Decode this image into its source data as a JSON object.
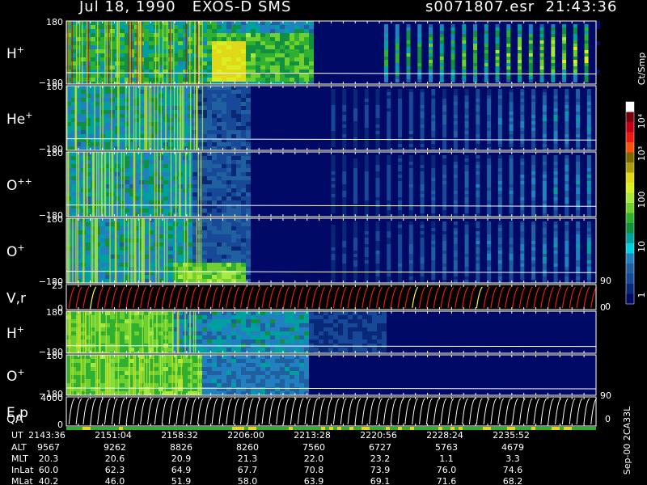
{
  "header": {
    "title": "Jul 18, 1990   EXOS-D SMS",
    "file_time": "s0071807.esr  21:43:36"
  },
  "colorbar": {
    "unit": "Ct/Smp",
    "labels": [
      "10⁴",
      "10³",
      "100",
      "10",
      "1"
    ],
    "colors": [
      "#ffffff",
      "#7a0010",
      "#c40014",
      "#ee1a10",
      "#ff5010",
      "#7a6a00",
      "#b09a10",
      "#e0d818",
      "#d8f020",
      "#a8e840",
      "#70d030",
      "#30b030",
      "#109040",
      "#00a0a0",
      "#00d0e0",
      "#2080c0",
      "#2060a0",
      "#184898",
      "#0a2878",
      "#000a66"
    ]
  },
  "panels": [
    {
      "name": "h-plus",
      "species": "H",
      "charge": "+",
      "ytop": "180",
      "ybot": "−180",
      "right_label": ""
    },
    {
      "name": "he-plus",
      "species": "He",
      "charge": "+",
      "ytop": "180",
      "ybot": "−180",
      "right_label": ""
    },
    {
      "name": "o-plus-plus",
      "species": "O",
      "charge": "++",
      "ytop": "180",
      "ybot": "−180",
      "right_label": ""
    },
    {
      "name": "o-plus",
      "species": "O",
      "charge": "+",
      "ytop": "180",
      "ybot": "−180",
      "right_label": "90"
    },
    {
      "name": "vr",
      "species": "V,r",
      "charge": "",
      "ytop": "25",
      "ybot": "0",
      "right_label": "0"
    },
    {
      "name": "h-plus-2",
      "species": "H",
      "charge": "+",
      "ytop": "180",
      "ybot": "−180",
      "right_label": ""
    },
    {
      "name": "o-plus-2",
      "species": "O",
      "charge": "+",
      "ytop": "180",
      "ybot": "−180",
      "right_label": ""
    },
    {
      "name": "ep",
      "species": "E,p",
      "charge": "",
      "ytop": "4000",
      "ybot": "0",
      "right_label": "90"
    }
  ],
  "qa_label": "QA",
  "ep_right_bottom": "0",
  "side_label": "Sep-00  2CA33L",
  "table": {
    "row_labels": [
      "UT",
      "ALT",
      "MLT",
      "InLat",
      "MLat"
    ],
    "columns": [
      [
        "2143:36",
        "9567",
        "20.3",
        "60.0",
        "40.2"
      ],
      [
        "2151:04",
        "9262",
        "20.6",
        "62.3",
        "46.0"
      ],
      [
        "2158:32",
        "8826",
        "20.9",
        "64.9",
        "51.9"
      ],
      [
        "2206:00",
        "8260",
        "21.3",
        "67.7",
        "58.0"
      ],
      [
        "2213:28",
        "7560",
        "22.0",
        "70.8",
        "63.9"
      ],
      [
        "2220:56",
        "6727",
        "23.2",
        "73.9",
        "69.1"
      ],
      [
        "2228:24",
        "5763",
        "1.1",
        "76.0",
        "71.6"
      ],
      [
        "2235:52",
        "4679",
        "3.3",
        "74.6",
        "68.2"
      ]
    ]
  },
  "chart_data": {
    "type": "heatmap",
    "title": "Jul 18, 1990   EXOS-D SMS",
    "x_ticks": [
      "2143:36",
      "2151:04",
      "2158:32",
      "2206:00",
      "2213:28",
      "2220:56",
      "2228:24",
      "2235:52"
    ],
    "colorbar_range": [
      1,
      10000
    ],
    "colorbar_scale": "log",
    "colorbar_unit": "Ct/Smp",
    "panels": [
      {
        "label": "H+",
        "ylim": [
          -180,
          180
        ]
      },
      {
        "label": "He+",
        "ylim": [
          -180,
          180
        ]
      },
      {
        "label": "O++",
        "ylim": [
          -180,
          180
        ]
      },
      {
        "label": "O+",
        "ylim": [
          -180,
          180
        ]
      },
      {
        "label": "V,r",
        "ylim": [
          0,
          25
        ]
      },
      {
        "label": "H+",
        "ylim": [
          -180,
          180
        ]
      },
      {
        "label": "O+",
        "ylim": [
          -180,
          180
        ]
      },
      {
        "label": "E,p",
        "ylim": [
          0,
          4000
        ]
      }
    ]
  }
}
